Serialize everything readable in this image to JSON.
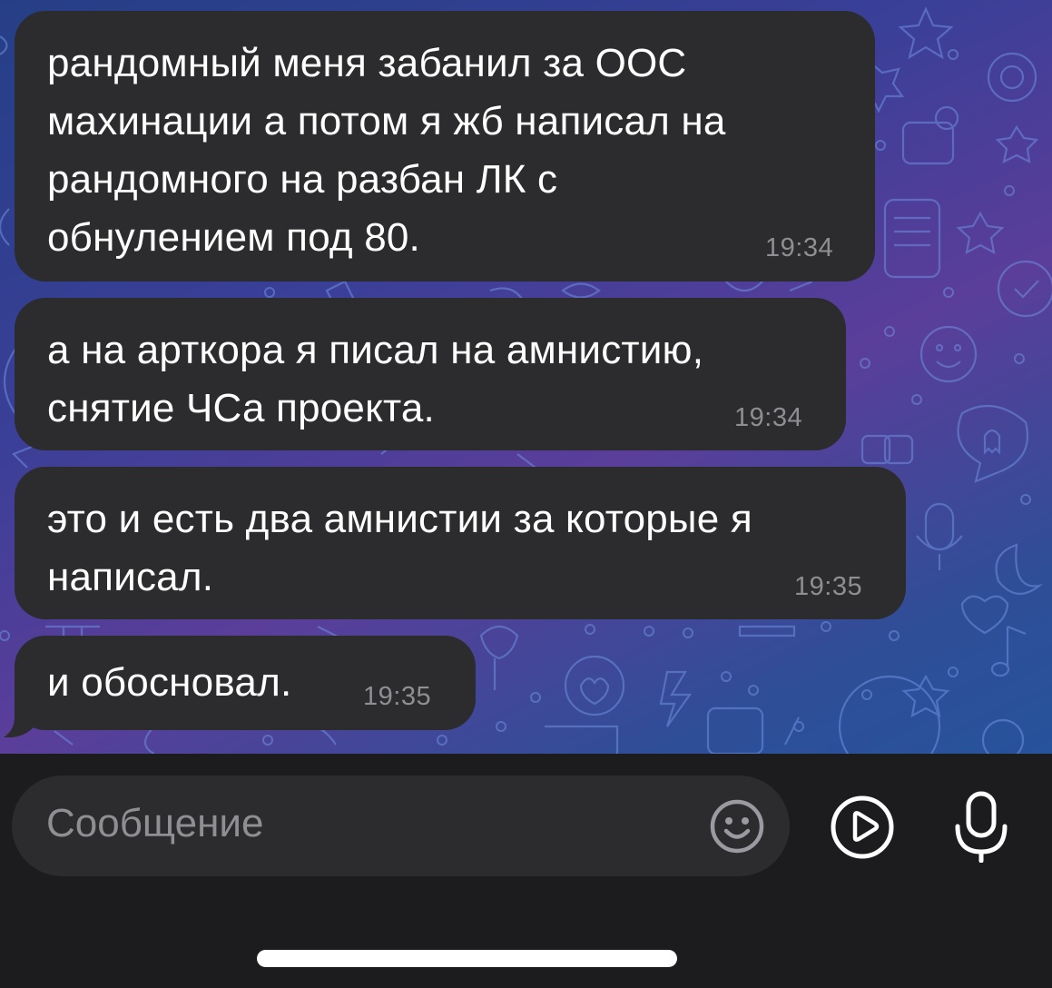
{
  "messages": [
    {
      "text": "рандомный меня забанил за ООС\nмахинации а потом я жб написал на\nрандомного на разбан ЛК с\nобнулением под 80.",
      "time": "19:34"
    },
    {
      "text": "а на арткора я писал на амнистию,\nснятие ЧСа проекта.",
      "time": "19:34"
    },
    {
      "text": "это и есть два амнистии за которые я\nнаписал.",
      "time": "19:35"
    },
    {
      "text": "и обосновал.",
      "time": "19:35"
    }
  ],
  "composer": {
    "placeholder": "Сообщение",
    "emoji_icon": "smile-icon",
    "video_message_icon": "play-circle-icon",
    "voice_icon": "microphone-icon"
  },
  "colors": {
    "bubble": "#2c2c2e",
    "text": "#ffffff",
    "time": "#8e8e93",
    "input_bg": "#1c1c1e",
    "field_bg": "#2c2c2e",
    "icon": "#ffffff"
  }
}
